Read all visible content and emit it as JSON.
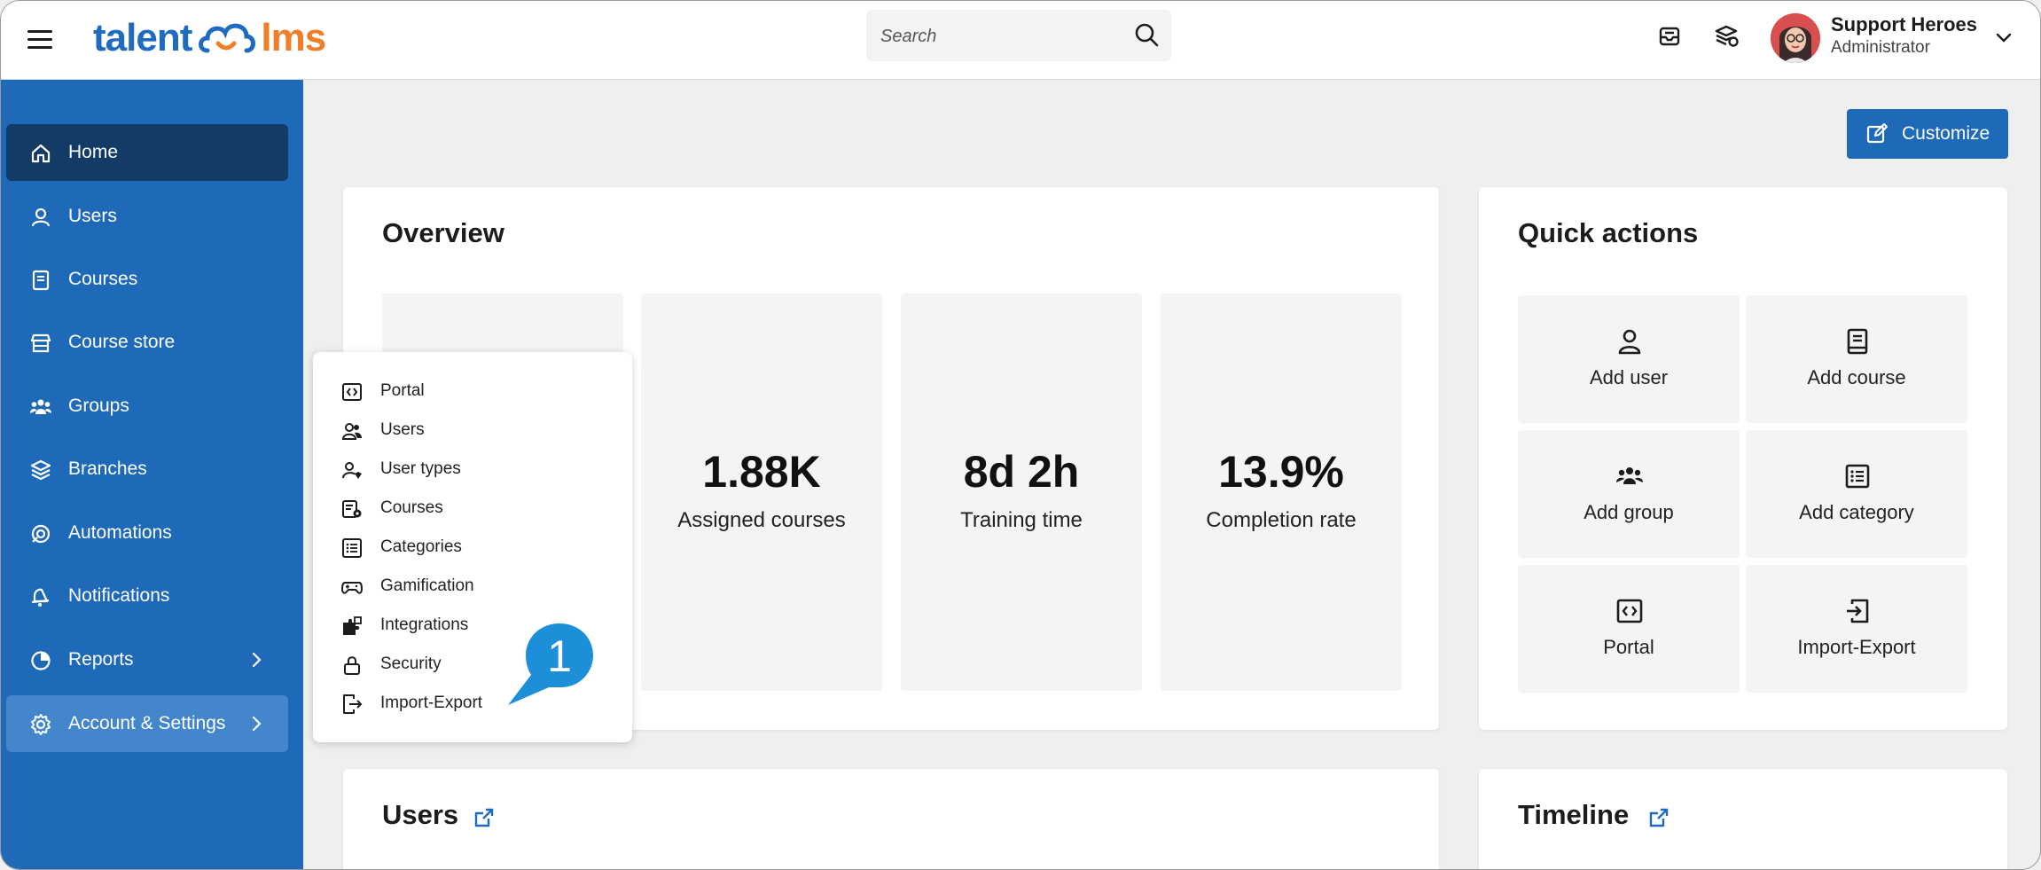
{
  "header": {
    "logo_left": "talent",
    "logo_right": "lms",
    "search_placeholder": "Search",
    "user_name": "Support Heroes",
    "user_role": "Administrator"
  },
  "sidebar": {
    "items": [
      {
        "label": "Home",
        "icon": "home-icon"
      },
      {
        "label": "Users",
        "icon": "user-icon"
      },
      {
        "label": "Courses",
        "icon": "book-icon"
      },
      {
        "label": "Course store",
        "icon": "store-icon"
      },
      {
        "label": "Groups",
        "icon": "groups-icon"
      },
      {
        "label": "Branches",
        "icon": "layers-icon"
      },
      {
        "label": "Automations",
        "icon": "automation-icon"
      },
      {
        "label": "Notifications",
        "icon": "bell-icon"
      },
      {
        "label": "Reports",
        "icon": "pie-chart-icon"
      },
      {
        "label": "Account & Settings",
        "icon": "gear-icon"
      }
    ]
  },
  "main": {
    "customize_label": "Customize",
    "overview": {
      "title": "Overview",
      "stats": [
        {
          "value": "1.88K",
          "label": "Assigned courses"
        },
        {
          "value": "8d 2h",
          "label": "Training time"
        },
        {
          "value": "13.9%",
          "label": "Completion rate"
        }
      ]
    },
    "quick_actions": {
      "title": "Quick actions",
      "items": [
        {
          "label": "Add user",
          "icon": "user-icon"
        },
        {
          "label": "Add course",
          "icon": "book-icon"
        },
        {
          "label": "Add group",
          "icon": "groups-icon"
        },
        {
          "label": "Add category",
          "icon": "list-icon"
        },
        {
          "label": "Portal",
          "icon": "code-icon"
        },
        {
          "label": "Import-Export",
          "icon": "import-icon"
        }
      ]
    },
    "users_title": "Users",
    "timeline_title": "Timeline"
  },
  "dropdown": {
    "items": [
      {
        "label": "Portal",
        "icon": "code-icon"
      },
      {
        "label": "Users",
        "icon": "users-icon"
      },
      {
        "label": "User types",
        "icon": "user-type-icon"
      },
      {
        "label": "Courses",
        "icon": "course-settings-icon"
      },
      {
        "label": "Categories",
        "icon": "list-icon"
      },
      {
        "label": "Gamification",
        "icon": "gamepad-icon"
      },
      {
        "label": "Integrations",
        "icon": "puzzle-icon"
      },
      {
        "label": "Security",
        "icon": "lock-icon"
      },
      {
        "label": "Import-Export",
        "icon": "export-icon"
      }
    ]
  },
  "callout": {
    "number": "1",
    "color": "#1d8fd8"
  },
  "colors": {
    "brand_blue": "#1e6ab9",
    "brand_orange": "#f07d28",
    "sidebar_active": "#143a66",
    "sidebar_open": "#4386cc"
  }
}
